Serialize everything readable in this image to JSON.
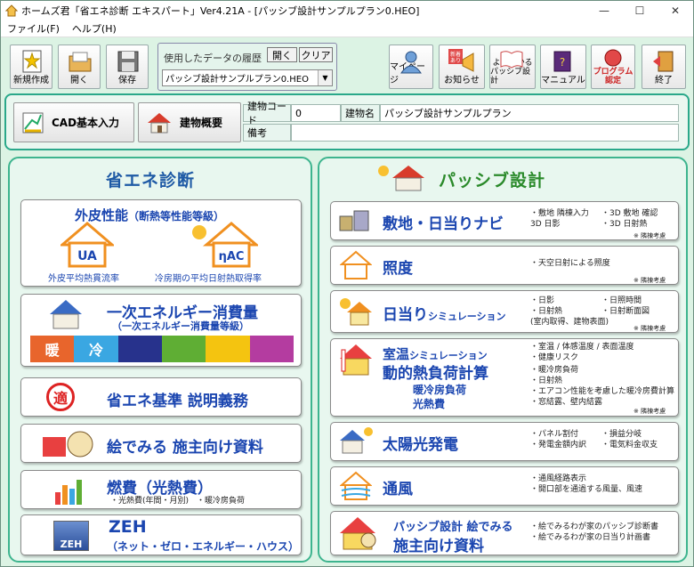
{
  "window": {
    "title": "ホームズ君「省エネ診断 エキスパート」Ver4.21A - [パッシブ設計サンプルプラン0.HEO]",
    "min": "—",
    "max": "☐",
    "close": "✕"
  },
  "menu": [
    "ファイル(F)",
    "ヘルプ(H)"
  ],
  "toolbar": {
    "new": "新規作成",
    "open": "開く",
    "save": "保存",
    "mypage": "マイページ",
    "notice": "お知らせ",
    "notice_badge1": "新着",
    "notice_badge2": "あり",
    "guide1": "よくわかる",
    "guide2": "パッシブ設計",
    "manual": "マニュアル",
    "prog1": "プログラム",
    "prog2": "認定",
    "exit": "終了"
  },
  "history": {
    "label": "使用したデータの履歴",
    "open": "開く",
    "clear": "クリア",
    "selected": "パッシブ設計サンプルプラン0.HEO"
  },
  "info": {
    "cad": "CAD基本入力",
    "overview": "建物概要",
    "code_label": "建物コード",
    "code_value": "0",
    "name_label": "建物名",
    "name_value": "パッシブ設計サンプルプラン",
    "note_label": "備考",
    "note_value": ""
  },
  "left": {
    "title": "省エネ診断",
    "envelope": {
      "title": "外皮性能",
      "sub": "（断熱等性能等級）",
      "ua_cap": "外皮平均熱貫流率",
      "eta_cap": "冷房期の平均日射熱取得率",
      "ua": "UA",
      "eta": "ηAC"
    },
    "energy": {
      "title": "一次エネルギー消費量",
      "sub": "（一次エネルギー消費量等級）",
      "icons": [
        "暖",
        "冷"
      ]
    },
    "standard": {
      "title": "省エネ基準 説明義務",
      "badge": "適"
    },
    "ehon": {
      "title": "絵でみる 施主向け資料"
    },
    "fuel": {
      "title": "燃費（光熱費）",
      "sub": "・光熱費(年間・月別)　・暖冷房負荷"
    },
    "zeh": {
      "title": "ZEH",
      "sub": "（ネット・ゼロ・エネルギー・ハウス）",
      "badge": "ZEH"
    }
  },
  "right": {
    "title": "パッシブ設計",
    "site": {
      "title": "敷地・日当りナビ",
      "l1": "・敷地 隣棟入力",
      "l2": "3D 日影",
      "r1": "・3D 敷地 確認",
      "r2": "・3D 日射熱",
      "note": "※ 隣棟考慮"
    },
    "lux": {
      "title": "照度",
      "l1": "・天空日射による照度",
      "note": "※ 隣棟考慮"
    },
    "sun": {
      "title": "日当り",
      "title2": "シミュレーション",
      "l1": "・日影",
      "l2": "・日射熱",
      "l3": "(室内取得、建物表面)",
      "r1": "・日照時間",
      "r2": "・日射断面図",
      "note": "※ 隣棟考慮"
    },
    "temp": {
      "title": "室温",
      "title2": "シミュレーション",
      "title3": "動的熱負荷計算",
      "sub1": "暖冷房負荷",
      "sub2": "光熱費",
      "l1": "・室温 / 体感温度 / 表面温度",
      "l2": "・健康リスク",
      "l3": "・暖冷房負荷",
      "l4": "・日射熱",
      "l5": "・エアコン性能を考慮した暖冷房費計算",
      "l6": "・窓結露、壁内結露",
      "note": "※ 隣棟考慮"
    },
    "solar": {
      "title": "太陽光発電",
      "l1": "・パネル割付",
      "l2": "・発電金額内訳",
      "r1": "・損益分岐",
      "r2": "・電気料金収支"
    },
    "wind": {
      "title": "通風",
      "l1": "・通風経路表示",
      "l2": "・開口部を通過する風量、風速"
    },
    "ehon": {
      "title1": "パッシブ設計 絵でみる",
      "title2": "施主向け資料",
      "l1": "・絵でみるわが家のパッシブ診断書",
      "l2": "・絵でみるわが家の日当り計画書"
    }
  }
}
